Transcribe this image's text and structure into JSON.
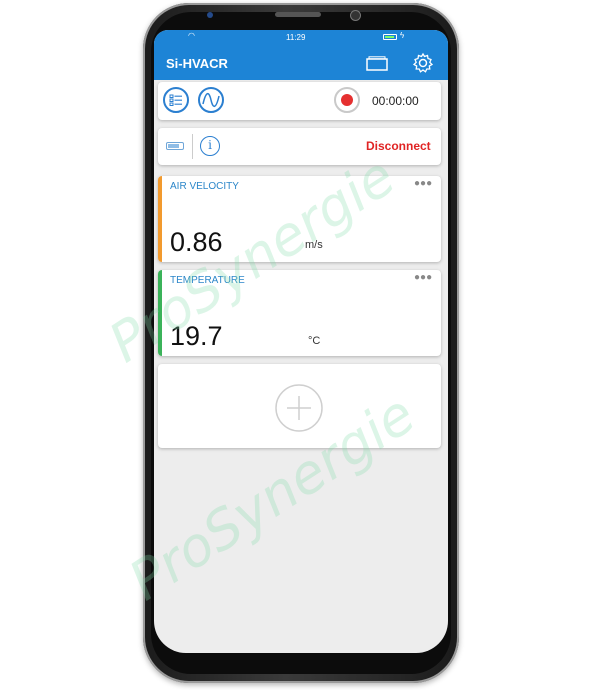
{
  "status_bar": {
    "time": "11:29"
  },
  "app_bar": {
    "title": "Si-HVACR",
    "folder_icon": "folder-icon",
    "settings_icon": "gear-icon"
  },
  "toolbar": {
    "list_icon": "list-icon",
    "wave_icon": "waveform-icon",
    "record_icon": "record-icon",
    "timer": "00:00:00"
  },
  "connection": {
    "battery_icon": "battery-icon",
    "info_icon": "info-icon",
    "disconnect_label": "Disconnect",
    "disconnect_color": "#e02424"
  },
  "sensors": [
    {
      "label": "AIR VELOCITY",
      "value": "0.86",
      "unit": "m/s",
      "accent": "#f29a2e"
    },
    {
      "label": "TEMPERATURE",
      "value": "19.7",
      "unit": "°C",
      "accent": "#3bb35a"
    }
  ],
  "add_sensor": {
    "icon": "plus-icon"
  },
  "more_icon": "more-icon",
  "watermark": "ProSynergie",
  "colors": {
    "primary": "#1d84d6",
    "label_blue": "#2b86c9"
  }
}
